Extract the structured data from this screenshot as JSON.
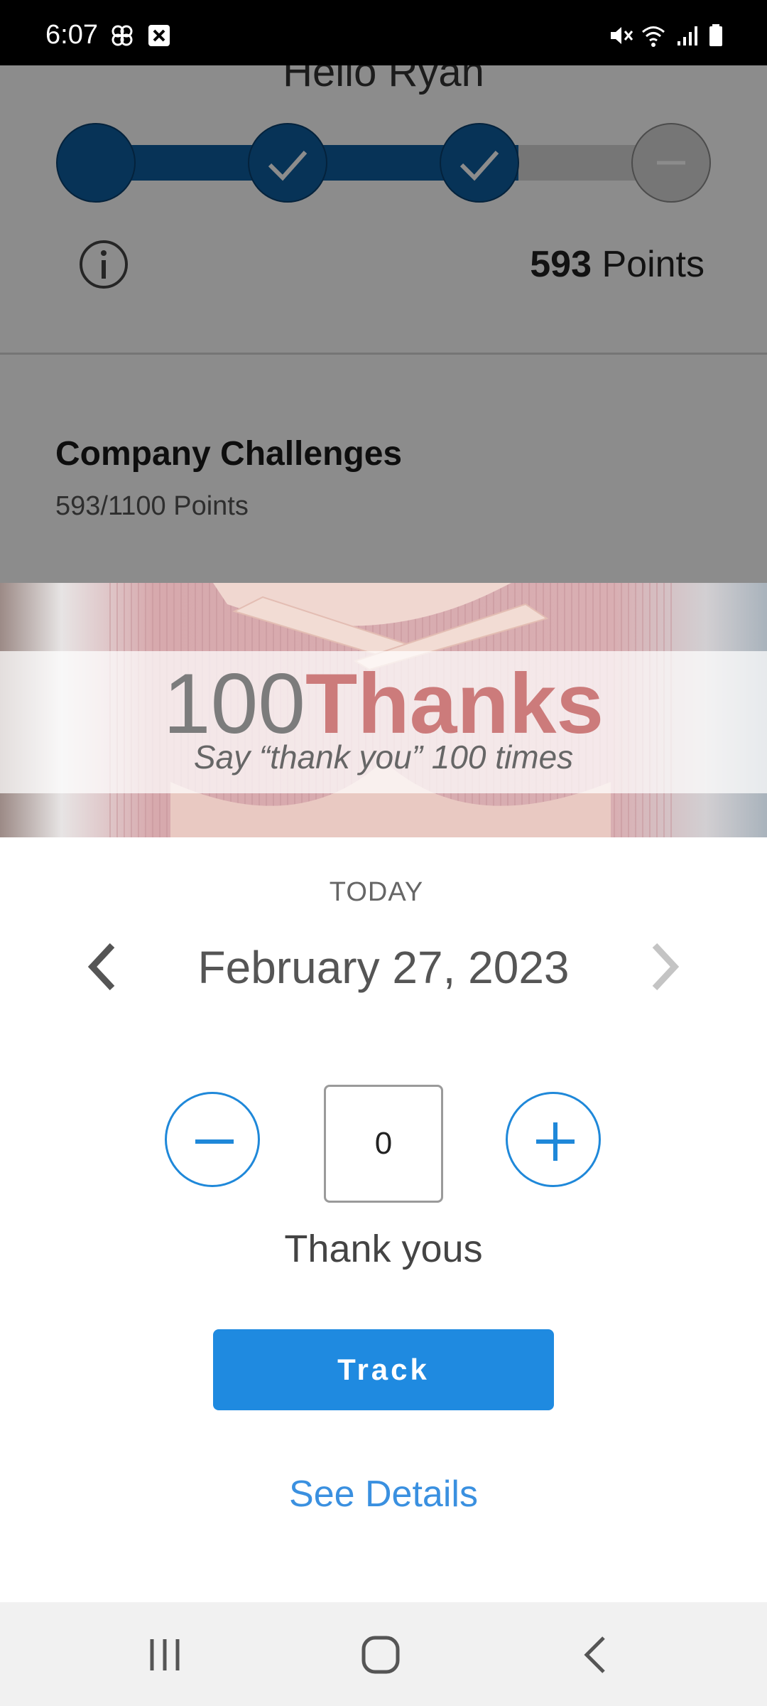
{
  "status_bar": {
    "time": "6:07",
    "icons": [
      "pinwheel-icon",
      "image-x-icon",
      "mute-icon",
      "wifi-icon",
      "signal-icon",
      "battery-icon"
    ]
  },
  "background_page": {
    "greeting": "Hello Ryan",
    "progress_steps": [
      {
        "state": "filled"
      },
      {
        "state": "checked"
      },
      {
        "state": "checked"
      },
      {
        "state": "dash"
      }
    ],
    "points_value": "593",
    "points_label": " Points",
    "card": {
      "title": "Company Challenges",
      "subtitle": "593/1100 Points"
    }
  },
  "challenge": {
    "hero_number": "100",
    "hero_word": "Thanks",
    "hero_subtitle": "Say “thank you” 100 times"
  },
  "tracker": {
    "day_label": "TODAY",
    "date": "February 27, 2023",
    "count": "0",
    "unit": "Thank yous",
    "track_button": "Track",
    "details_link": "See Details"
  },
  "colors": {
    "accent": "#1f88d9",
    "progress_fill": "#0d5d9e",
    "link": "#3a90e0",
    "hero_word": "#cc7b7b"
  },
  "nav_bar": {
    "icons": [
      "recent-apps-icon",
      "home-icon",
      "back-icon"
    ]
  }
}
